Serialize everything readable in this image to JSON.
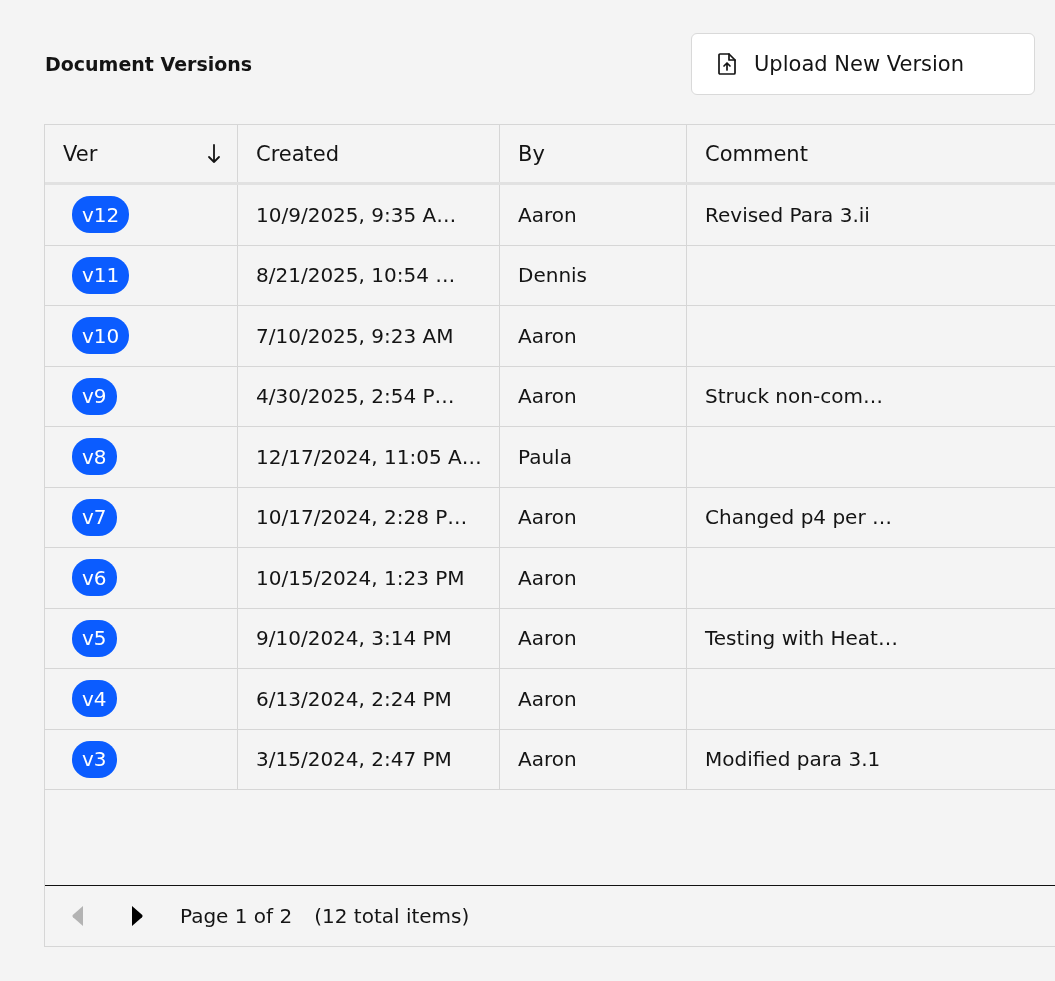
{
  "header": {
    "title": "Document Versions",
    "upload_button": {
      "label": "Upload New Version"
    }
  },
  "table": {
    "columns": [
      {
        "label": "Ver",
        "sorted_descending": true
      },
      {
        "label": "Created",
        "sorted_descending": false
      },
      {
        "label": "By",
        "sorted_descending": false
      },
      {
        "label": "Comment",
        "sorted_descending": false
      }
    ],
    "rows": [
      {
        "version": "v12",
        "created": "10/9/2025, 9:35 A…",
        "by": "Aaron",
        "comment": "Revised Para 3.ii"
      },
      {
        "version": "v11",
        "created": "8/21/2025, 10:54 …",
        "by": "Dennis"
      },
      {
        "version": "v10",
        "created": "7/10/2025, 9:23 AM",
        "by": "Aaron"
      },
      {
        "version": "v9",
        "created": "4/30/2025, 2:54 P…",
        "by": "Aaron",
        "comment": "Struck non-com…"
      },
      {
        "version": "v8",
        "created": "12/17/2024, 11:05 A…",
        "by": "Paula"
      },
      {
        "version": "v7",
        "created": "10/17/2024, 2:28 P…",
        "by": "Aaron",
        "comment": "Changed p4 per …"
      },
      {
        "version": "v6",
        "created": "10/15/2024, 1:23 PM",
        "by": "Aaron"
      },
      {
        "version": "v5",
        "created": "9/10/2024, 3:14 PM",
        "by": "Aaron",
        "comment": "Testing with Heat…"
      },
      {
        "version": "v4",
        "created": "6/13/2024, 2:24 PM",
        "by": "Aaron"
      },
      {
        "version": "v3",
        "created": "3/15/2024, 2:47 PM",
        "by": "Aaron",
        "comment": "Modified para 3.1"
      }
    ]
  },
  "pager": {
    "previous": {
      "disabled": true
    },
    "next": {
      "disabled": false
    },
    "page_text": "Page 1 of 2",
    "total_text": "(12 total items)"
  }
}
